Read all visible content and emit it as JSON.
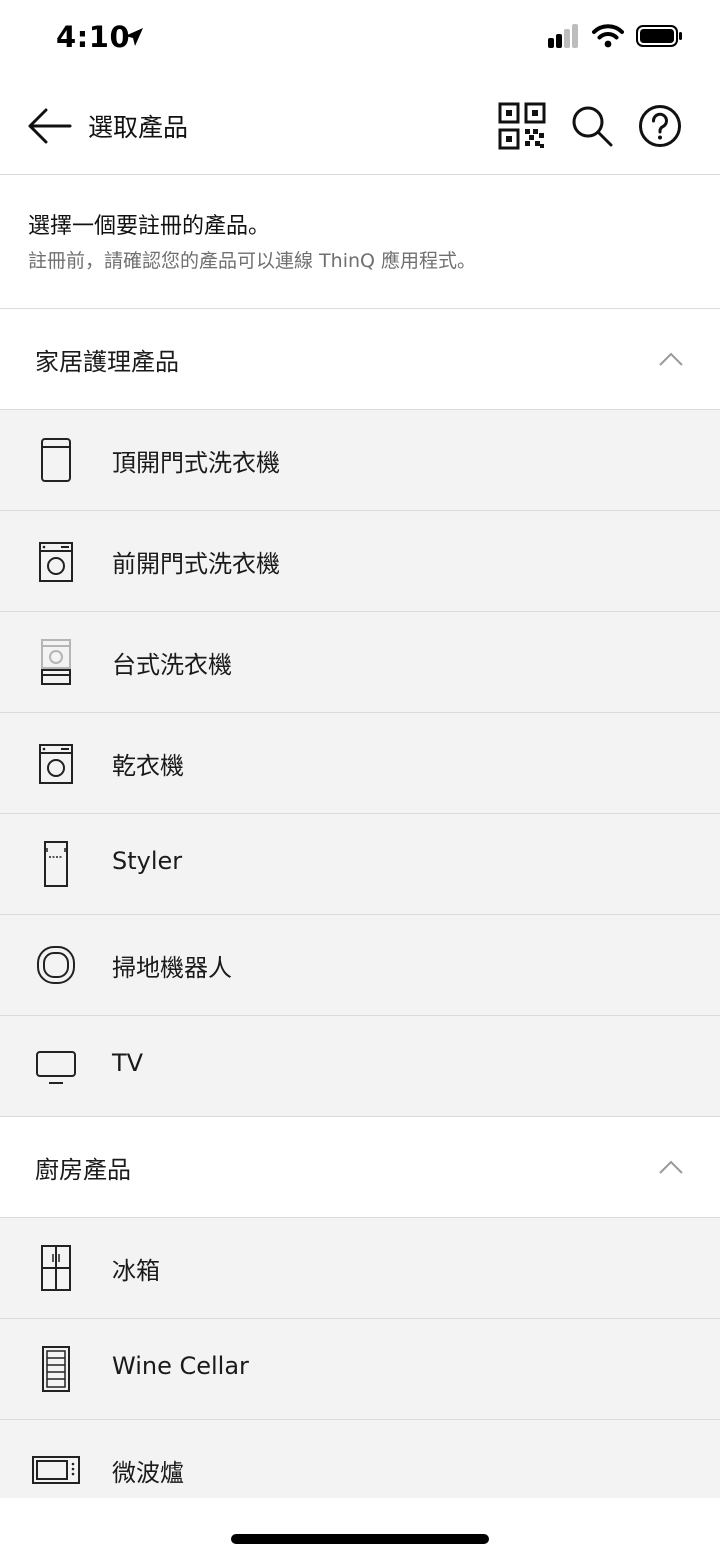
{
  "status_bar": {
    "time": "4:10",
    "icons": [
      "location-arrow-icon",
      "cellular-signal-icon",
      "wifi-icon",
      "battery-icon"
    ]
  },
  "app_bar": {
    "title": "選取產品",
    "icons": [
      "back-arrow-icon",
      "qr-code-icon",
      "search-icon",
      "help-icon"
    ]
  },
  "intro": {
    "title": "選擇一個要註冊的產品。",
    "subtitle": "註冊前，請確認您的產品可以連線 ThinQ 應用程式。"
  },
  "sections": [
    {
      "title": "家居護理產品",
      "expanded": true,
      "items": [
        {
          "label": "頂開門式洗衣機",
          "icon": "top-load-washer-icon"
        },
        {
          "label": "前開門式洗衣機",
          "icon": "front-load-washer-icon"
        },
        {
          "label": "台式洗衣機",
          "icon": "pedestal-washer-icon"
        },
        {
          "label": "乾衣機",
          "icon": "dryer-icon"
        },
        {
          "label": "Styler",
          "icon": "styler-icon"
        },
        {
          "label": "掃地機器人",
          "icon": "robot-vacuum-icon"
        },
        {
          "label": "TV",
          "icon": "tv-icon"
        }
      ]
    },
    {
      "title": "廚房產品",
      "expanded": true,
      "items": [
        {
          "label": "冰箱",
          "icon": "refrigerator-icon"
        },
        {
          "label": "Wine Cellar",
          "icon": "wine-cellar-icon"
        },
        {
          "label": "微波爐",
          "icon": "microwave-icon"
        }
      ]
    }
  ],
  "colors": {
    "background": "#ffffff",
    "item_background": "#f3f3f3",
    "divider": "#dadada",
    "text_primary": "#1a1a1a",
    "text_secondary": "#707070"
  }
}
